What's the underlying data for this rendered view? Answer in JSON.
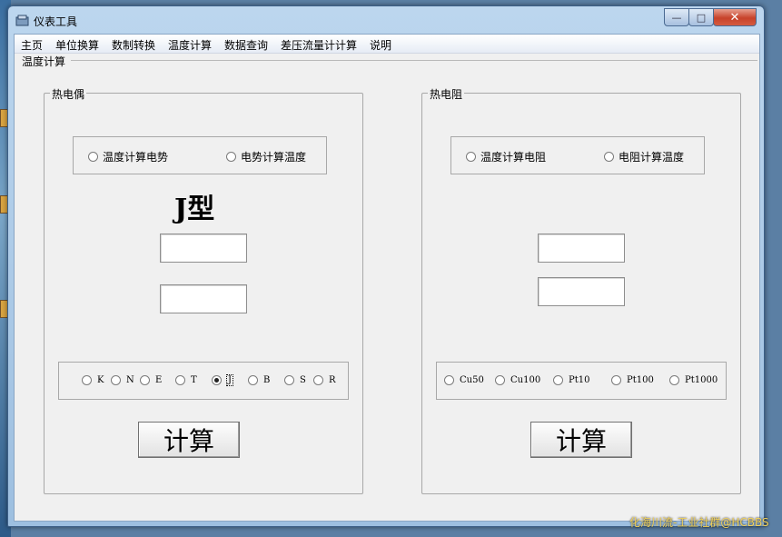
{
  "window": {
    "title": "仪表工具"
  },
  "menu": [
    "主页",
    "单位换算",
    "数制转换",
    "温度计算",
    "数据查询",
    "差压流量计计算",
    "说明"
  ],
  "tab": {
    "title": "温度计算"
  },
  "thermocouple": {
    "group_title": "热电偶",
    "mode_options": [
      "温度计算电势",
      "电势计算温度"
    ],
    "type_label": "J型",
    "input1_value": "",
    "input2_value": "",
    "types": [
      "K",
      "N",
      "E",
      "T",
      "J",
      "B",
      "S",
      "R"
    ],
    "selected_type": "J",
    "calc_label": "计算"
  },
  "rtd": {
    "group_title": "热电阻",
    "mode_options": [
      "温度计算电阻",
      "电阻计算温度"
    ],
    "input1_value": "",
    "input2_value": "",
    "types": [
      "Cu50",
      "Cu100",
      "Pt10",
      "Pt100",
      "Pt1000"
    ],
    "calc_label": "计算"
  },
  "watermark": "化海川流-工业社群@HCBBS"
}
